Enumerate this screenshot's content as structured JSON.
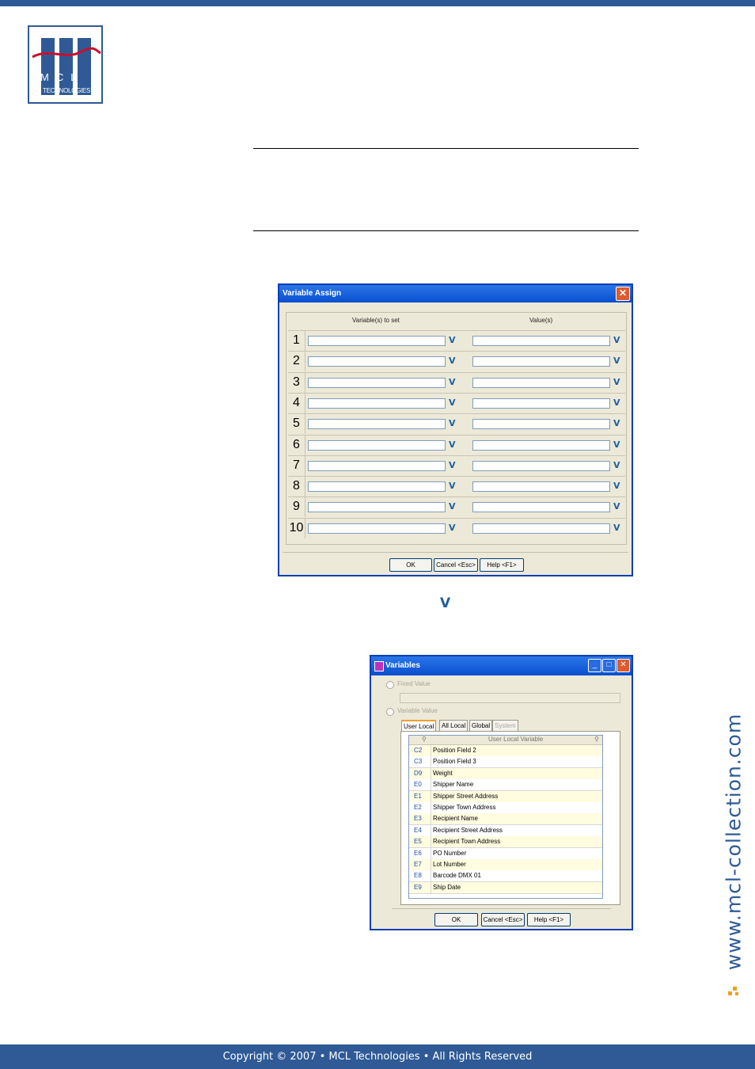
{
  "header": {
    "logo_letters": "MCL",
    "logo_subtitle": "TECHNOLOGIES"
  },
  "sidebar_url": "www.mcl-collection.com",
  "footer": {
    "text": "Copyright © 2007 • MCL Technologies • All Rights Reserved"
  },
  "dialog_variable_assign": {
    "title": "Variable Assign",
    "col_variables": "Variable(s) to set",
    "col_values": "Value(s)",
    "rows": [
      "1",
      "2",
      "3",
      "4",
      "5",
      "6",
      "7",
      "8",
      "9",
      "10"
    ],
    "dropdown_glyph": "V",
    "buttons": {
      "ok": "OK",
      "cancel": "Cancel <Esc>",
      "help": "Help <F1>"
    }
  },
  "dropdown_symbol": "V",
  "dialog_variables": {
    "title": "Variables",
    "fixed_value": "Fixed Value",
    "variable_value": "Variable Value",
    "tabs": [
      "User Local",
      "All Local",
      "Global",
      "System"
    ],
    "table_header": "User Local Variable",
    "rows": [
      {
        "code": "C2",
        "name": "Position Field 2"
      },
      {
        "code": "C3",
        "name": "Position Field 3"
      },
      {
        "code": "D9",
        "name": "Weight"
      },
      {
        "code": "E0",
        "name": "Shipper Name"
      },
      {
        "code": "E1",
        "name": "Shipper Street Address"
      },
      {
        "code": "E2",
        "name": "Shipper Town Address"
      },
      {
        "code": "E3",
        "name": "Recipient Name"
      },
      {
        "code": "E4",
        "name": "Recipient Street Address"
      },
      {
        "code": "E5",
        "name": "Recipient Town Address"
      },
      {
        "code": "E6",
        "name": "PO Number"
      },
      {
        "code": "E7",
        "name": "Lot Number"
      },
      {
        "code": "E8",
        "name": "Barcode DMX 01"
      },
      {
        "code": "E9",
        "name": "Ship Date"
      }
    ],
    "buttons": {
      "ok": "OK",
      "cancel": "Cancel <Esc>",
      "help": "Help <F1>"
    }
  },
  "colors": {
    "brand": "#2f5a96",
    "accent_red": "#c8102e"
  }
}
